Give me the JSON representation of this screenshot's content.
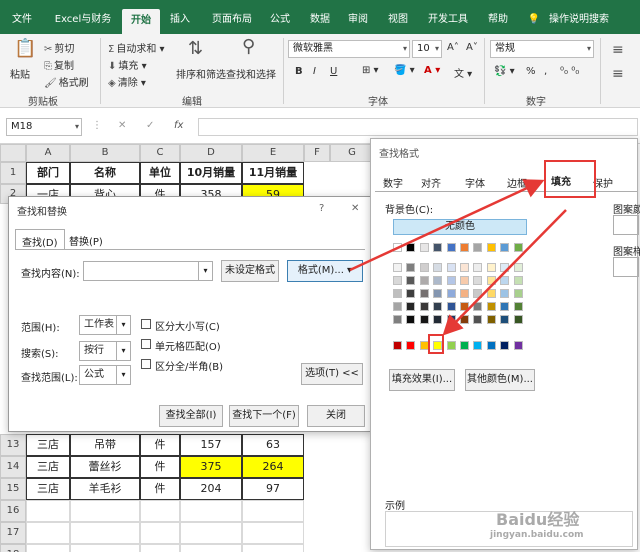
{
  "tabs": [
    "文件",
    "Excel与财务",
    "开始",
    "插入",
    "页面布局",
    "公式",
    "数据",
    "审阅",
    "视图",
    "开发工具",
    "帮助",
    "操作说明搜索"
  ],
  "ribbon": {
    "paste": "粘贴",
    "cut": "剪切",
    "copy": "复制",
    "format_painter": "格式刷",
    "clipboard_label": "剪贴板",
    "autosum": "自动求和",
    "fill": "填充",
    "clear": "清除",
    "sort_filter": "排序和筛选",
    "find_select": "查找和选择",
    "editing_label": "编辑",
    "font_name": "微软雅黑",
    "font_size": "10",
    "font_label": "字体",
    "number_format": "常规",
    "number_label": "数字",
    "bold": "B",
    "italic": "I",
    "underline": "U",
    "grow_font": "A˄",
    "shrink_font": "A˅",
    "percent": "%",
    "comma": ","
  },
  "formula_bar": {
    "name_box": "M18",
    "fx": "fx"
  },
  "columns": [
    "A",
    "B",
    "C",
    "D",
    "E",
    "F",
    "G"
  ],
  "table": {
    "header": [
      "部门",
      "名称",
      "单位",
      "10月销量",
      "11月销量"
    ],
    "row2": [
      "一店",
      "背心",
      "件",
      "358",
      "59"
    ],
    "rows_bottom": [
      {
        "num": "13",
        "cells": [
          "三店",
          "吊带",
          "件",
          "157",
          "63"
        ]
      },
      {
        "num": "14",
        "cells": [
          "三店",
          "蕾丝衫",
          "件",
          "375",
          "264"
        ]
      },
      {
        "num": "15",
        "cells": [
          "三店",
          "羊毛衫",
          "件",
          "204",
          "97"
        ]
      },
      {
        "num": "16",
        "cells": [
          "",
          "",
          "",
          "",
          ""
        ]
      },
      {
        "num": "17",
        "cells": [
          "",
          "",
          "",
          "",
          ""
        ]
      },
      {
        "num": "18",
        "cells": [
          "",
          "",
          "",
          "",
          ""
        ]
      }
    ],
    "row_nums_top": [
      "1",
      "2"
    ]
  },
  "find_dialog": {
    "title": "查找和替换",
    "help": "?",
    "close": "✕",
    "tab_find": "查找(D)",
    "tab_replace": "替换(P)",
    "find_label": "查找内容(N):",
    "not_set": "未设定格式",
    "format_btn": "格式(M)...",
    "range_label": "范围(H):",
    "range_value": "工作表",
    "search_label": "搜索(S):",
    "search_value": "按行",
    "lookin_label": "查找范围(L):",
    "lookin_value": "公式",
    "match_case": "区分大小写(C)",
    "match_cell": "单元格匹配(O)",
    "match_byte": "区分全/半角(B)",
    "options_btn": "选项(T) <<",
    "find_all": "查找全部(I)",
    "find_next": "查找下一个(F)",
    "close_btn": "关闭"
  },
  "format_dialog": {
    "title": "查找格式",
    "tabs": [
      "数字",
      "对齐",
      "字体",
      "边框",
      "填充",
      "保护"
    ],
    "bg_label": "背景色(C):",
    "no_color": "无颜色",
    "fill_effects": "填充效果(I)...",
    "more_colors": "其他颜色(M)...",
    "pattern_color": "图案颜色",
    "pattern_style": "图案样式",
    "sample": "示例"
  },
  "colors": {
    "accent": "#217346",
    "highlight": "#ffff00",
    "annotation": "#e53935",
    "no_color_bg": "#cde8f7"
  },
  "watermark": {
    "line1": "Baidu经验",
    "line2": "jingyan.baidu.com"
  }
}
